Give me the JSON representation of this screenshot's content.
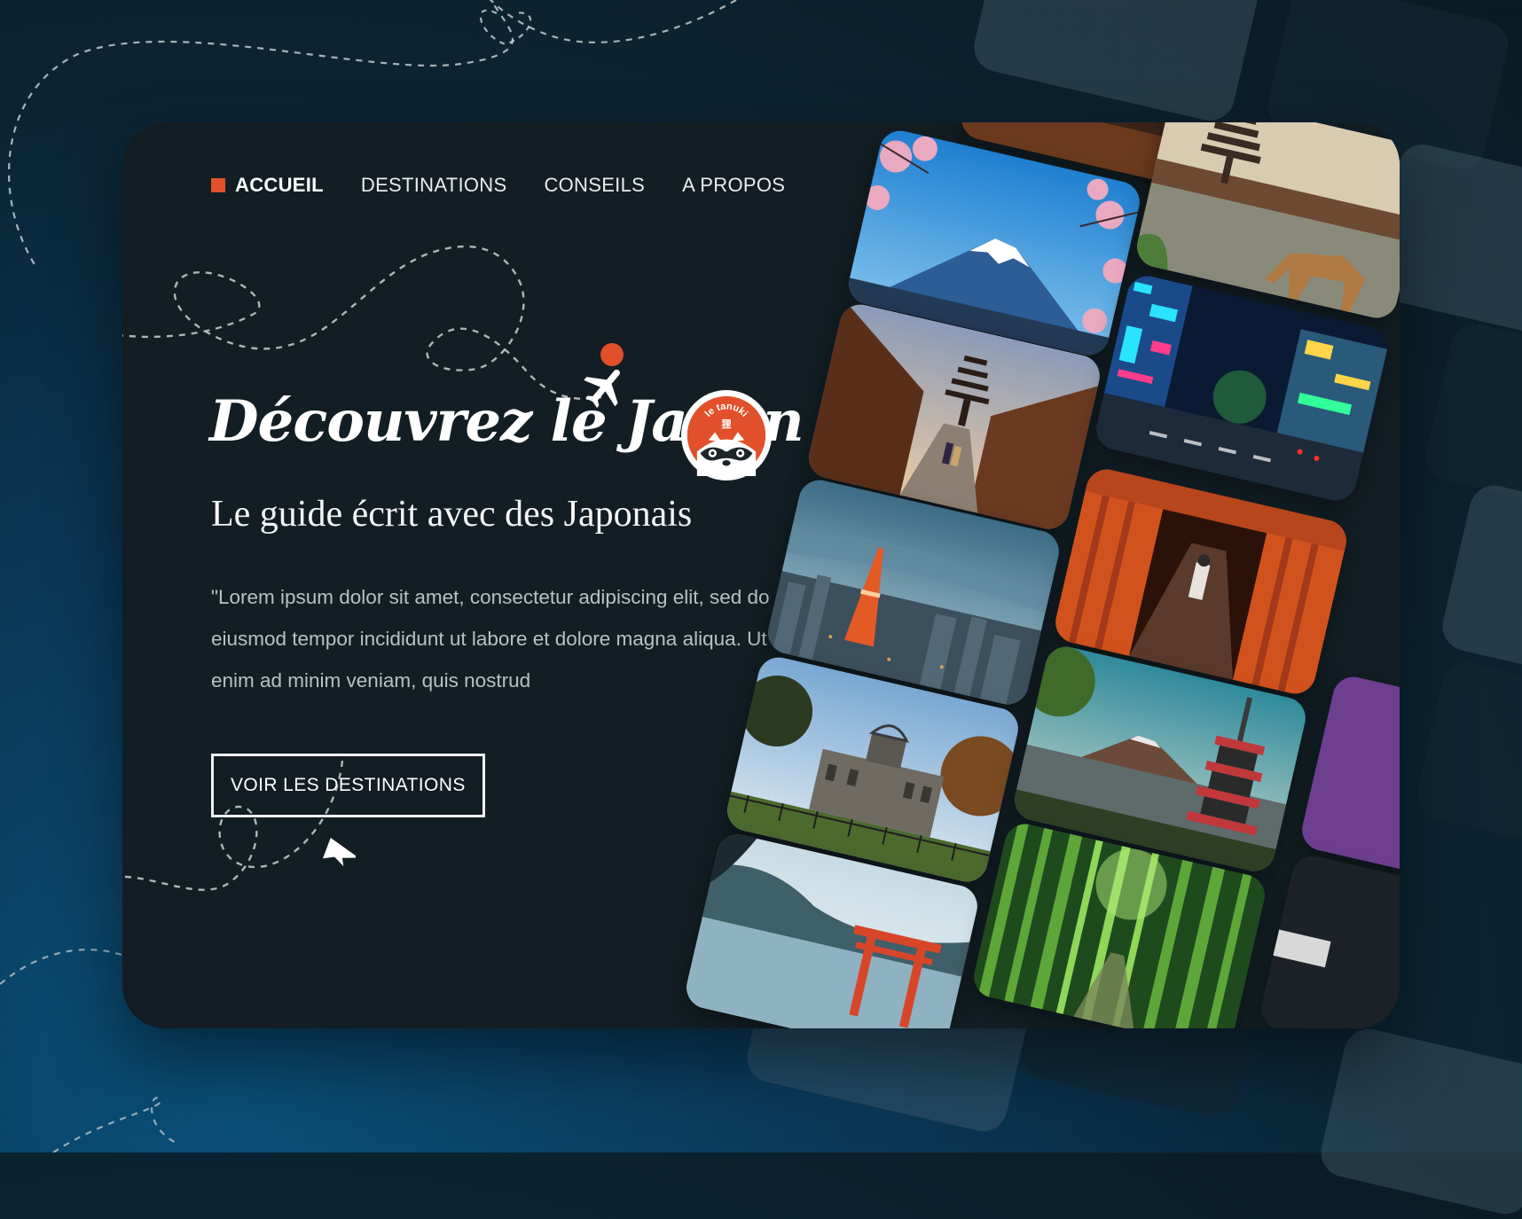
{
  "nav": {
    "items": [
      {
        "label": "ACCUEIL",
        "active": true
      },
      {
        "label": "DESTINATIONS",
        "active": false
      },
      {
        "label": "CONSEILS",
        "active": false
      },
      {
        "label": "A PROPOS",
        "active": false
      }
    ]
  },
  "hero": {
    "title": "Découvrez le Japon",
    "subtitle": "Le guide écrit avec des Japonais",
    "body": "\"Lorem ipsum dolor sit amet, consectetur adipiscing elit, sed do  eiusmod tempor incididunt ut labore et dolore magna aliqua. Ut enim ad  minim veniam, quis nostrud",
    "cta_label": "VOIR LES DESTINATIONS"
  },
  "logo": {
    "text": "le tanuki",
    "kanji": "狸"
  },
  "gallery": {
    "photos": [
      {
        "subject": "Mont Fuji et cerisiers"
      },
      {
        "subject": "Cerf de Nara et pagode"
      },
      {
        "subject": "Rue de Kyoto et pagode"
      },
      {
        "subject": "Quartier néon de Tokyo"
      },
      {
        "subject": "Tour de Tokyo"
      },
      {
        "subject": "Torii de Fushimi Inari"
      },
      {
        "subject": "Dôme de Genbaku"
      },
      {
        "subject": "Pagode Chureito et Fuji"
      },
      {
        "subject": "Torii flottant de Miyajima"
      },
      {
        "subject": "Forêt de bambous"
      }
    ]
  },
  "colors": {
    "accent": "#e1502a",
    "card_background": "#121e24",
    "text_primary": "#ffffff",
    "text_muted": "#b9c0c4"
  },
  "icons": [
    "airplane-icon",
    "paper-plane-icon",
    "sun-icon",
    "tanuki-logo-icon"
  ]
}
